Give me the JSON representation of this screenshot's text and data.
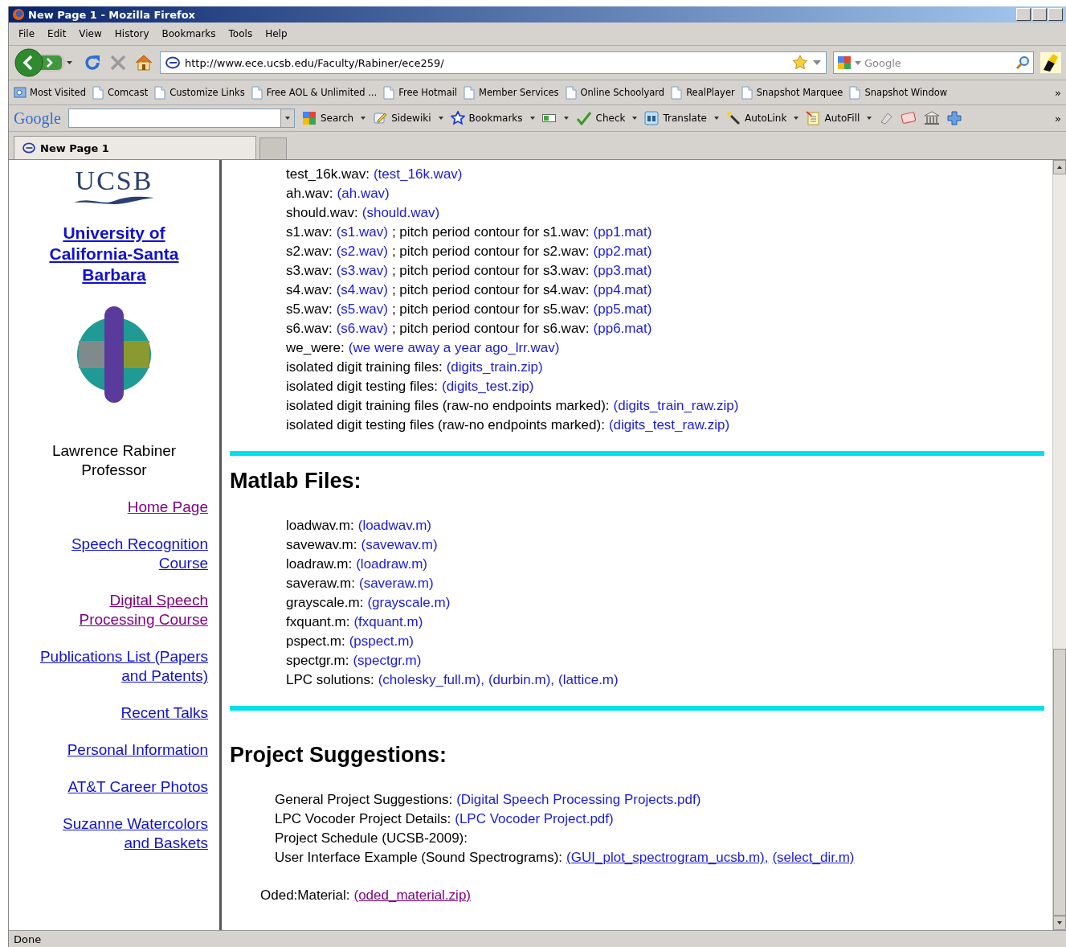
{
  "window": {
    "title": "New Page 1 - Mozilla Firefox"
  },
  "menu": [
    "File",
    "Edit",
    "View",
    "History",
    "Bookmarks",
    "Tools",
    "Help"
  ],
  "address": {
    "url": "http://www.ece.ucsb.edu/Faculty/Rabiner/ece259/"
  },
  "search": {
    "placeholder": "Google"
  },
  "bookmarks": {
    "items": [
      "Most Visited",
      "Comcast",
      "Customize Links",
      "Free AOL & Unlimited ...",
      "Free Hotmail",
      "Member Services",
      "Online Schoolyard",
      "RealPlayer",
      "Snapshot Marquee",
      "Snapshot Window"
    ],
    "overflow": "»"
  },
  "google_toolbar": {
    "logo": "Google",
    "items": [
      {
        "kind": "button",
        "label": "Search"
      },
      {
        "kind": "button",
        "label": "Sidewiki"
      },
      {
        "kind": "button",
        "label": "Bookmarks"
      },
      {
        "kind": "icon"
      },
      {
        "kind": "button",
        "label": "Check"
      },
      {
        "kind": "button",
        "label": "Translate"
      },
      {
        "kind": "button",
        "label": "AutoLink"
      },
      {
        "kind": "button",
        "label": "AutoFill"
      }
    ],
    "overflow": "»"
  },
  "tabs": [
    {
      "label": "New Page 1",
      "selected": true
    }
  ],
  "sidebar": {
    "logo": "UCSB",
    "university": [
      "University of",
      "California-Santa",
      "Barbara"
    ],
    "name": "Lawrence Rabiner",
    "role": "Professor",
    "links": [
      {
        "lines": [
          "Home Page"
        ],
        "visited": true
      },
      {
        "lines": [
          "Speech Recognition",
          "Course"
        ],
        "visited": false
      },
      {
        "lines": [
          "Digital Speech",
          "Processing Course"
        ],
        "visited": true
      },
      {
        "lines": [
          "Publications List (Papers",
          "and Patents)"
        ],
        "visited": false
      },
      {
        "lines": [
          "Recent Talks"
        ],
        "visited": false
      },
      {
        "lines": [
          "Personal Information"
        ],
        "visited": false
      },
      {
        "lines": [
          "AT&T Career Photos"
        ],
        "visited": false
      },
      {
        "lines": [
          "Suzanne Watercolors",
          "and Baskets"
        ],
        "visited": false
      }
    ]
  },
  "files": [
    [
      {
        "kind": "text",
        "text": "test_16k.wav:"
      },
      {
        "kind": "link",
        "text": "(test_16k.wav)",
        "visited": false,
        "underlined": false
      }
    ],
    [
      {
        "kind": "text",
        "text": "ah.wav:"
      },
      {
        "kind": "link",
        "text": "(ah.wav)",
        "visited": false,
        "underlined": false
      }
    ],
    [
      {
        "kind": "text",
        "text": "should.wav:"
      },
      {
        "kind": "link",
        "text": "(should.wav)",
        "visited": false,
        "underlined": false
      }
    ],
    [
      {
        "kind": "text",
        "text": "s1.wav:"
      },
      {
        "kind": "link",
        "text": "(s1.wav)",
        "visited": false,
        "underlined": false
      },
      {
        "kind": "text",
        "text": "; pitch period contour for s1.wav:"
      },
      {
        "kind": "link",
        "text": "(pp1.mat)",
        "visited": false,
        "underlined": false
      }
    ],
    [
      {
        "kind": "text",
        "text": "s2.wav:"
      },
      {
        "kind": "link",
        "text": "(s2.wav)",
        "visited": false,
        "underlined": false
      },
      {
        "kind": "text",
        "text": "; pitch period contour for s2.wav:"
      },
      {
        "kind": "link",
        "text": "(pp2.mat)",
        "visited": false,
        "underlined": false
      }
    ],
    [
      {
        "kind": "text",
        "text": "s3.wav:"
      },
      {
        "kind": "link",
        "text": "(s3.wav)",
        "visited": false,
        "underlined": false
      },
      {
        "kind": "text",
        "text": "; pitch period contour for s3.wav:"
      },
      {
        "kind": "link",
        "text": "(pp3.mat)",
        "visited": false,
        "underlined": false
      }
    ],
    [
      {
        "kind": "text",
        "text": "s4.wav:"
      },
      {
        "kind": "link",
        "text": "(s4.wav)",
        "visited": false,
        "underlined": false
      },
      {
        "kind": "text",
        "text": "; pitch period contour for s4.wav:"
      },
      {
        "kind": "link",
        "text": "(pp4.mat)",
        "visited": false,
        "underlined": false
      }
    ],
    [
      {
        "kind": "text",
        "text": "s5.wav:"
      },
      {
        "kind": "link",
        "text": "(s5.wav)",
        "visited": false,
        "underlined": false
      },
      {
        "kind": "text",
        "text": "; pitch period contour for s5.wav:"
      },
      {
        "kind": "link",
        "text": "(pp5.mat)",
        "visited": false,
        "underlined": false
      }
    ],
    [
      {
        "kind": "text",
        "text": "s6.wav:"
      },
      {
        "kind": "link",
        "text": "(s6.wav)",
        "visited": false,
        "underlined": false
      },
      {
        "kind": "text",
        "text": "; pitch period contour for s6.wav:"
      },
      {
        "kind": "link",
        "text": "(pp6.mat)",
        "visited": false,
        "underlined": false
      }
    ],
    [
      {
        "kind": "text",
        "text": "we_were:"
      },
      {
        "kind": "link",
        "text": "(we were away a year ago_lrr.wav)",
        "visited": false,
        "underlined": false
      }
    ],
    [
      {
        "kind": "text",
        "text": "isolated digit training files:"
      },
      {
        "kind": "link",
        "text": "(digits_train.zip)",
        "visited": false,
        "underlined": false
      }
    ],
    [
      {
        "kind": "text",
        "text": "isolated digit testing files:"
      },
      {
        "kind": "link",
        "text": "(digits_test.zip)",
        "visited": false,
        "underlined": false
      }
    ],
    [
      {
        "kind": "text",
        "text": "isolated digit training files (raw-no endpoints marked):"
      },
      {
        "kind": "link",
        "text": "(digits_train_raw.zip)",
        "visited": false,
        "underlined": false
      }
    ],
    [
      {
        "kind": "text",
        "text": "isolated digit testing files (raw-no endpoints marked):"
      },
      {
        "kind": "link",
        "text": "(digits_test_raw.zip)",
        "visited": false,
        "underlined": false
      }
    ]
  ],
  "matlab": {
    "heading": "Matlab Files:",
    "lines": [
      [
        {
          "kind": "text",
          "text": "loadwav.m:"
        },
        {
          "kind": "link",
          "text": "(loadwav.m)",
          "visited": false,
          "underlined": false
        }
      ],
      [
        {
          "kind": "text",
          "text": "savewav.m:"
        },
        {
          "kind": "link",
          "text": "(savewav.m)",
          "visited": false,
          "underlined": false
        }
      ],
      [
        {
          "kind": "text",
          "text": "loadraw.m:"
        },
        {
          "kind": "link",
          "text": "(loadraw.m)",
          "visited": false,
          "underlined": false
        }
      ],
      [
        {
          "kind": "text",
          "text": "saveraw.m:"
        },
        {
          "kind": "link",
          "text": "(saveraw.m)",
          "visited": false,
          "underlined": false
        }
      ],
      [
        {
          "kind": "text",
          "text": "grayscale.m:"
        },
        {
          "kind": "link",
          "text": "(grayscale.m)",
          "visited": false,
          "underlined": false
        }
      ],
      [
        {
          "kind": "text",
          "text": "fxquant.m:"
        },
        {
          "kind": "link",
          "text": "(fxquant.m)",
          "visited": false,
          "underlined": false
        }
      ],
      [
        {
          "kind": "text",
          "text": "pspect.m:"
        },
        {
          "kind": "link",
          "text": "(pspect.m)",
          "visited": false,
          "underlined": false
        }
      ],
      [
        {
          "kind": "text",
          "text": "spectgr.m:"
        },
        {
          "kind": "link",
          "text": "(spectgr.m)",
          "visited": false,
          "underlined": false
        }
      ],
      [
        {
          "kind": "text",
          "text": "LPC solutions:"
        },
        {
          "kind": "link",
          "text": "(cholesky_full.m),",
          "visited": false,
          "underlined": false
        },
        {
          "kind": "link",
          "text": "(durbin.m),",
          "visited": false,
          "underlined": false
        },
        {
          "kind": "link",
          "text": "(lattice.m)",
          "visited": false,
          "underlined": false
        }
      ]
    ]
  },
  "projects": {
    "heading": "Project Suggestions:",
    "lines": [
      [
        {
          "kind": "text",
          "text": "General Project Suggestions:"
        },
        {
          "kind": "link",
          "text": "(Digital Speech Processing Projects.pdf)",
          "visited": false,
          "underlined": false
        }
      ],
      [
        {
          "kind": "text",
          "text": "LPC Vocoder Project Details:"
        },
        {
          "kind": "link",
          "text": "(LPC Vocoder Project.pdf)",
          "visited": false,
          "underlined": false
        }
      ],
      [
        {
          "kind": "text",
          "text": "Project Schedule (UCSB-2009):"
        }
      ],
      [
        {
          "kind": "text",
          "text": "User Interface Example (Sound Spectrograms):"
        },
        {
          "kind": "link",
          "text": "(GUI_plot_spectrogram_ucsb.m),",
          "visited": false,
          "underlined": true
        },
        {
          "kind": "link",
          "text": "(select_dir.m)",
          "visited": false,
          "underlined": true
        }
      ]
    ]
  },
  "oded": [
    {
      "kind": "text",
      "text": "Oded:Material:"
    },
    {
      "kind": "link",
      "text": "(oded_material.zip)",
      "visited": true,
      "underlined": true
    }
  ],
  "status_bar": {
    "text": "Done"
  }
}
